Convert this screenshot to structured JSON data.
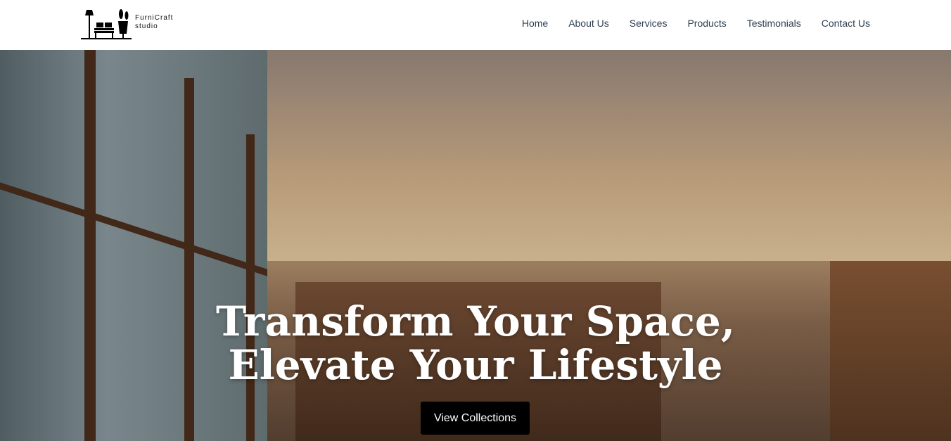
{
  "logo": {
    "line1": "FurniCraft",
    "line2": "studio"
  },
  "nav": [
    "Home",
    "About Us",
    "Services",
    "Products",
    "Testimonials",
    "Contact Us"
  ],
  "hero": {
    "line1": "Transform Your Space,",
    "line2": "Elevate Your Lifestyle",
    "button": "View Collections"
  }
}
